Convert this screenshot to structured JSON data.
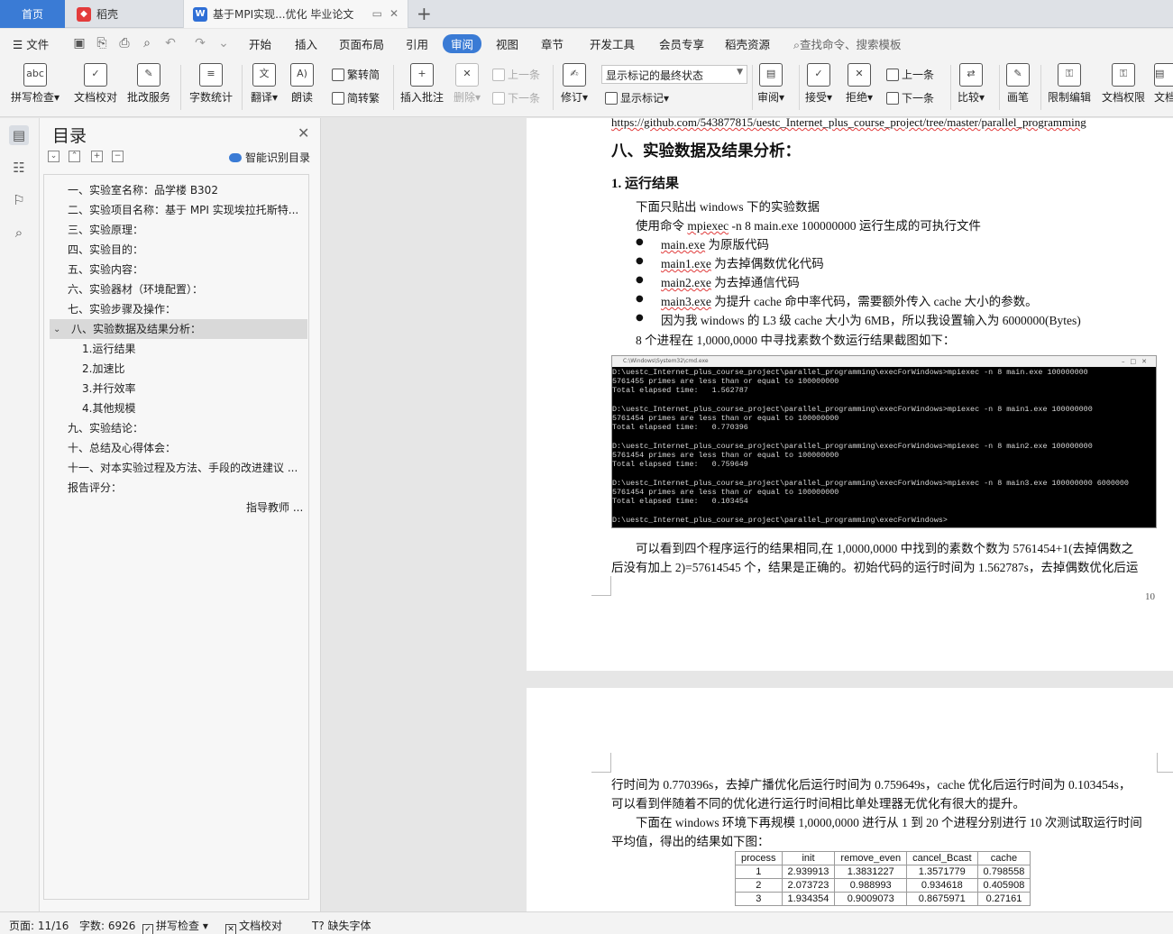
{
  "tabs": {
    "home": "首页",
    "daoke": "稻壳",
    "doc": "基于MPI实现...优化 毕业论文",
    "new_tab": "+"
  },
  "menu": {
    "file": "文件",
    "items": [
      "开始",
      "插入",
      "页面布局",
      "引用",
      "审阅",
      "视图",
      "章节",
      "开发工具",
      "会员专享",
      "稻壳资源"
    ],
    "search": "查找命令、搜索模板"
  },
  "ribbon": {
    "spell": "拼写检查",
    "proof": "文档校对",
    "batch": "批改服务",
    "wordcount": "字数统计",
    "translate": "翻译",
    "read": "朗读",
    "trad": "繁转简",
    "simp": "简转繁",
    "insert_comment": "插入批注",
    "delete": "删除",
    "prev1": "上一条",
    "next1": "下一条",
    "revise": "修订",
    "markup_state": "显示标记的最终状态",
    "show_markup": "显示标记",
    "review": "审阅",
    "accept": "接受",
    "reject": "拒绝",
    "prev2": "上一条",
    "next2": "下一条",
    "compare": "比较",
    "pen": "画笔",
    "restrict": "限制编辑",
    "rights": "文档权限",
    "more": "文档"
  },
  "toc": {
    "title": "目录",
    "smart": "智能识别目录",
    "items": [
      "一、实验室名称：品学楼 B302",
      "二、实验项目名称：基于 MPI 实现埃拉托斯特...",
      "三、实验原理：",
      "四、实验目的：",
      "五、实验内容：",
      "六、实验器材（环境配置）：",
      "七、实验步骤及操作：",
      "八、实验数据及结果分析：",
      "1.运行结果",
      "2.加速比",
      "3.并行效率",
      "4.其他规模",
      "九、实验结论：",
      "十、总结及心得体会：",
      "十一、对本实验过程及方法、手段的改进建议 ...",
      "报告评分：",
      "指导教师 ..."
    ]
  },
  "doc": {
    "url": "https://github.com/543877815/uestc_Internet_plus_course_project/tree/master/parallel_programming",
    "h8": "八、实验数据及结果分析：",
    "h81": "1. 运行结果",
    "p1": "下面只贴出 windows 下的实验数据",
    "p2a": "使用命令 ",
    "p2b": "mpiexec",
    "p2c": " -n 8 main.exe 100000000 运行生成的可执行文件",
    "b1a": "main.exe",
    "b1b": " 为原版代码",
    "b2a": "main1.exe",
    "b2b": " 为去掉偶数优化代码",
    "b3a": "main2.exe",
    "b3b": " 为去掉通信代码",
    "b4a": "main3.exe",
    "b4b": " 为提升  cache  命中率代码，需要额外传入 cache 大小的参数。",
    "b5": "因为我 windows 的 L3 级 cache 大小为 6MB，所以我设置输入为 6000000(Bytes)",
    "p3": "8 个进程在 1,0000,0000 中寻找素数个数运行结果截图如下：",
    "term_title": "C:\\Windows\\System32\\cmd.exe",
    "term_lines": [
      "D:\\uestc_Internet_plus_course_project\\parallel_programming\\execForWindows>mpiexec -n 8 main.exe 100000000",
      "5761455 primes are less than or equal to 100000000",
      "Total elapsed time:   1.562787",
      "",
      "D:\\uestc_Internet_plus_course_project\\parallel_programming\\execForWindows>mpiexec -n 8 main1.exe 100000000",
      "5761454 primes are less than or equal to 100000000",
      "Total elapsed time:   0.770396",
      "",
      "D:\\uestc_Internet_plus_course_project\\parallel_programming\\execForWindows>mpiexec -n 8 main2.exe 100000000",
      "5761454 primes are less than or equal to 100000000",
      "Total elapsed time:   0.759649",
      "",
      "D:\\uestc_Internet_plus_course_project\\parallel_programming\\execForWindows>mpiexec -n 8 main3.exe 100000000 6000000",
      "5761454 primes are less than or equal to 100000000",
      "Total elapsed time:   0.103454",
      "",
      "D:\\uestc_Internet_plus_course_project\\parallel_programming\\execForWindows>"
    ],
    "p4": "可以看到四个程序运行的结果相同,在 1,0000,0000 中找到的素数个数为 5761454+1(去掉偶数之",
    "p5": "后没有加上 2)=57614545 个，结果是正确的。初始代码的运行时间为 1.562787s，去掉偶数优化后运",
    "page_num": "10",
    "p6": "行时间为 0.770396s，去掉广播优化后运行时间为 0.759649s，cache 优化后运行时间为 0.103454s，",
    "p7": "可以看到伴随着不同的优化进行运行时间相比单处理器无优化有很大的提升。",
    "p8": "下面在 windows 环境下再规模 1,0000,0000 进行从 1 到 20 个进程分别进行 10 次测试取运行时间",
    "p9": "平均值，得出的结果如下图：",
    "table": {
      "headers": [
        "process",
        "init",
        "remove_even",
        "cancel_Bcast",
        "cache"
      ],
      "rows": [
        [
          "1",
          "2.939913",
          "1.3831227",
          "1.3571779",
          "0.798558"
        ],
        [
          "2",
          "2.073723",
          "0.988993",
          "0.934618",
          "0.405908"
        ],
        [
          "3",
          "1.934354",
          "0.9009073",
          "0.8675971",
          "0.27161"
        ]
      ]
    }
  },
  "status": {
    "page": "页面: 11/16",
    "words": "字数: 6926",
    "spell": "拼写检查",
    "proof": "文档校对",
    "font": "缺失字体"
  }
}
